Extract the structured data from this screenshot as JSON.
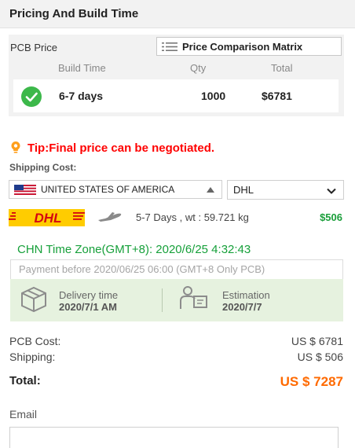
{
  "header": {
    "title": "Pricing And Build Time"
  },
  "pcb_price": {
    "label": "PCB Price",
    "matrix_button": "Price Comparison Matrix",
    "columns": [
      "Build Time",
      "Qty",
      "Total"
    ],
    "selected_row": {
      "build_time": "6-7 days",
      "qty": "1000",
      "total": "$6781"
    }
  },
  "tip": {
    "text": "Tip:Final price can be negotiated."
  },
  "shipping": {
    "label": "Shipping Cost:",
    "country": "UNITED STATES OF AMERICA",
    "carrier": "DHL",
    "carrier_logo": "DHL",
    "days_weight": "5-7 Days ,  wt : 59.721 kg",
    "cost": "$506"
  },
  "time_zone": {
    "text": "CHN Time Zone(GMT+8): 2020/6/25 4:32:43"
  },
  "payment": {
    "text": "Payment before 2020/06/25 06:00 (GMT+8 Only PCB)"
  },
  "delivery": {
    "delivery_label": "Delivery time",
    "delivery_value": "2020/7/1 AM",
    "estimation_label": "Estimation",
    "estimation_value": "2020/7/7"
  },
  "summary": {
    "pcb_cost_label": "PCB Cost:",
    "pcb_cost_value": "US $ 6781",
    "shipping_label": "Shipping:",
    "shipping_value": "US $ 506",
    "total_label": "Total:",
    "total_value": "US $ 7287"
  },
  "email": {
    "label": "Email",
    "value": ""
  },
  "colors": {
    "green_text": "#16a03a",
    "tip_red": "#ff0000",
    "total_orange": "#ff6a00",
    "delivery_bg": "#e6f2df",
    "dhl_yellow": "#ffcc00",
    "dhl_red": "#d40511"
  },
  "icons": [
    "list-icon",
    "check-icon",
    "bulb-icon",
    "flag-us-icon",
    "chevron-up-icon",
    "chevron-down-icon",
    "dhl-logo",
    "plane-icon",
    "box-icon",
    "worker-icon"
  ]
}
